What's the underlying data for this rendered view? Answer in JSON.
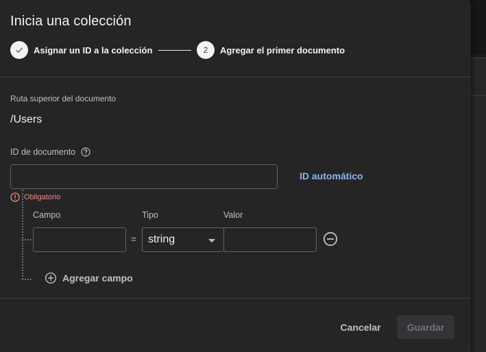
{
  "dialog": {
    "title": "Inicia una colección",
    "steps": [
      {
        "label": "Asignar un ID a la colección",
        "state": "done"
      },
      {
        "number": "2",
        "label": "Agregar el primer documento",
        "state": "current"
      }
    ],
    "parent_path_label": "Ruta superior del documento",
    "parent_path": "/Users",
    "doc_id_label": "ID de documento",
    "doc_id_value": "",
    "auto_id_label": "ID automático",
    "error_text": "Obligatorio",
    "columns": {
      "field": "Campo",
      "type": "Tipo",
      "value": "Valor"
    },
    "field_row": {
      "field": "",
      "equals": "=",
      "type": "string",
      "value": ""
    },
    "add_field_label": "Agregar campo",
    "cancel_label": "Cancelar",
    "save_label": "Guardar"
  },
  "icons": {
    "step_done": "check-icon",
    "help": "help-circle-icon",
    "error": "error-circle-icon",
    "remove": "remove-circle-icon",
    "add": "add-circle-icon",
    "type_caret": "caret-down-icon"
  },
  "colors": {
    "accent_link": "#8ab4f8",
    "error": "#f28b82",
    "dialog_bg": "#252526"
  }
}
